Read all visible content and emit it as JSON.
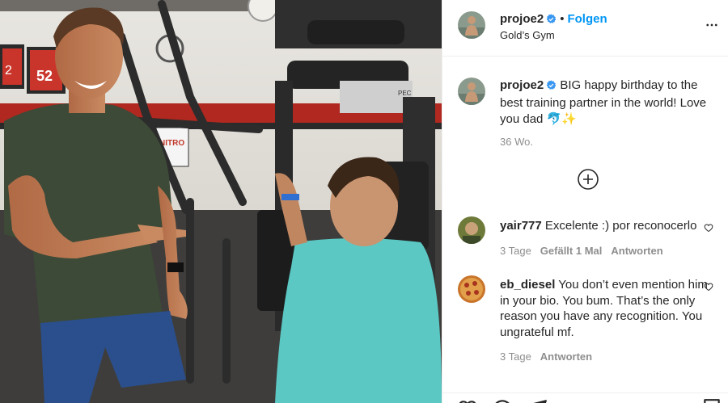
{
  "post": {
    "username": "projoe2",
    "follow_label": "Folgen",
    "location": "Gold’s Gym",
    "verified": true
  },
  "caption": {
    "username": "projoe2",
    "text": "BIG happy birthday to the best training partner in the world! Love you dad 🐬✨",
    "age": "36 Wo."
  },
  "comments": [
    {
      "username": "yair777",
      "text": "Excelente :) por reconocerlo",
      "age": "3 Tage",
      "likes": "Gefällt 1 Mal",
      "reply_label": "Antworten"
    },
    {
      "username": "eb_diesel",
      "text": "You don’t even mention him in your bio. You bum. That’s the only reason you have any recognition. You ungrateful mf.",
      "age": "3 Tage",
      "reply_label": "Antworten"
    }
  ],
  "photo": {
    "jersey_numbers": [
      "2",
      "52"
    ],
    "sign_text": "NITRO",
    "machine_text": "PEC"
  },
  "icons": {
    "more": "more-options-icon",
    "load_more": "plus-circle-icon",
    "like": "heart-icon",
    "comment": "comment-icon",
    "share": "paper-plane-icon",
    "save": "bookmark-icon",
    "verified": "verified-badge-icon"
  },
  "colors": {
    "link": "#0095f6",
    "verified": "#3897f0",
    "secondary_text": "#8e8e8e",
    "text": "#262626"
  }
}
